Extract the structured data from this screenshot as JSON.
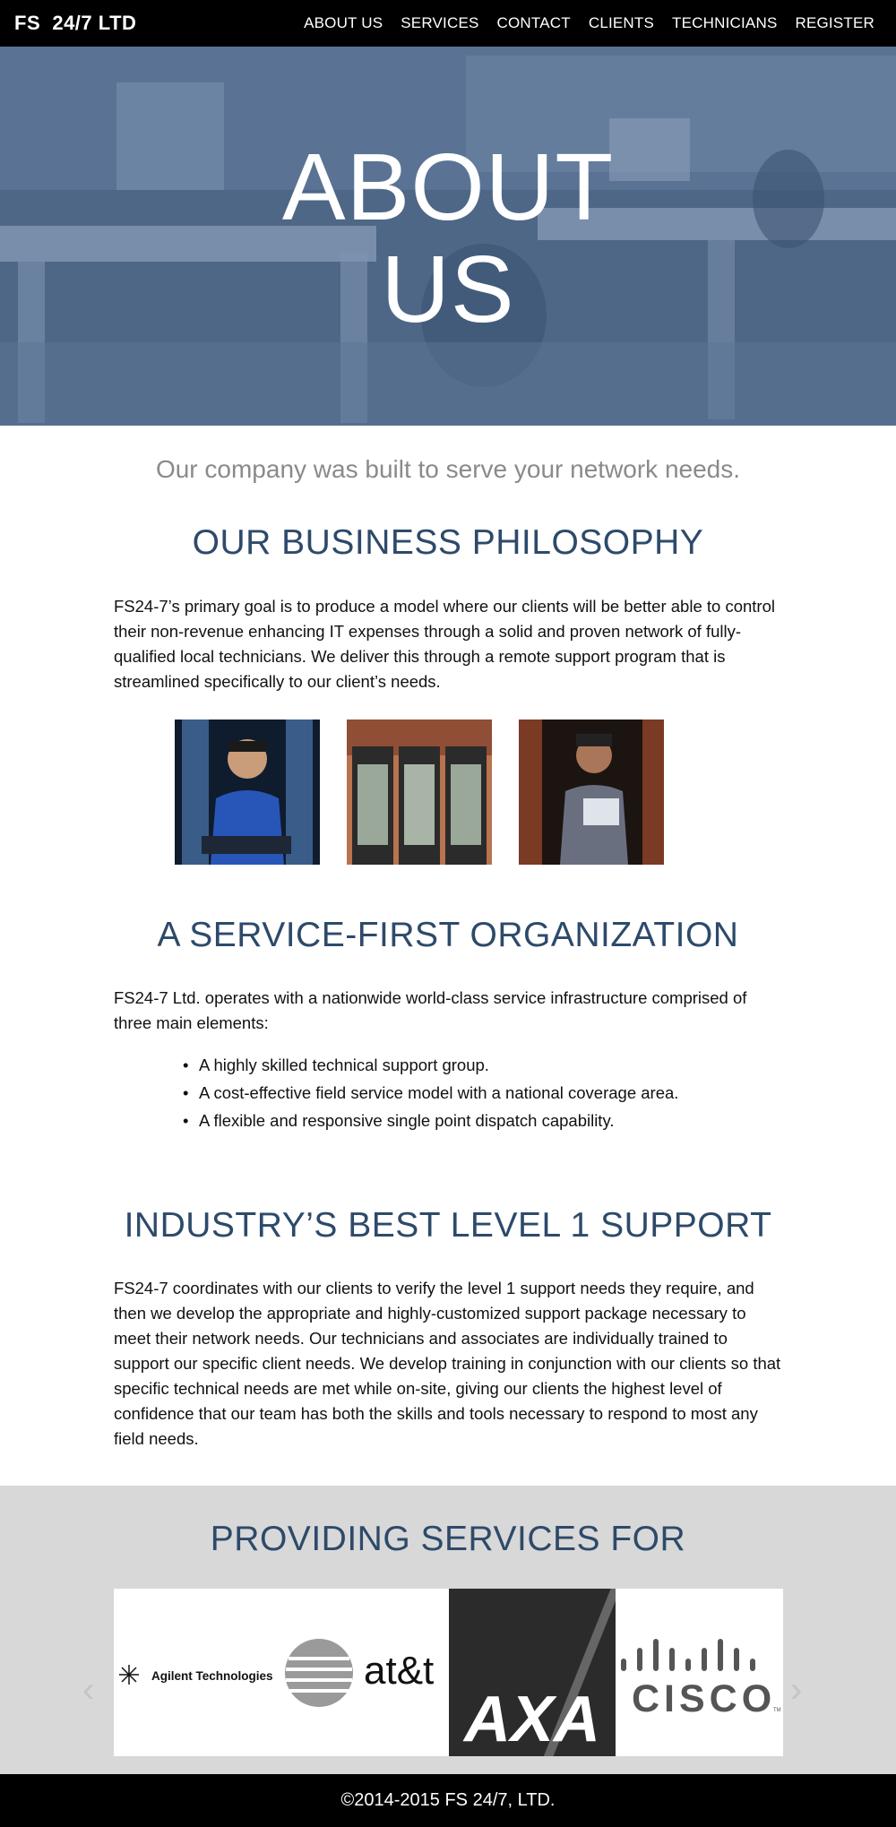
{
  "nav": {
    "brand": "FS  24/7 LTD",
    "links": [
      "ABOUT US",
      "SERVICES",
      "CONTACT",
      "CLIENTS",
      "TECHNICIANS",
      "REGISTER"
    ]
  },
  "hero": {
    "title_line1": "ABOUT",
    "title_line2": "US"
  },
  "tagline": "Our company was built to serve your network needs.",
  "philosophy": {
    "heading": "OUR BUSINESS PHILOSOPHY",
    "body": "FS24-7’s primary goal is to produce a model where our clients will be better able to control their non-revenue enhancing IT expenses through a solid and proven network of fully-qualified local technicians. We deliver this through a remote support program that is streamlined specifically to our client’s needs.",
    "photos": [
      "technician-at-server-photo",
      "server-racks-photo",
      "technician-with-tablet-photo"
    ]
  },
  "service_first": {
    "heading": "A SERVICE-FIRST ORGANIZATION",
    "body": "FS24-7 Ltd. operates with a nationwide world-class service infrastructure comprised of three main elements:",
    "bullets": [
      "A highly skilled technical support group.",
      "A cost-effective field service model with a national coverage area.",
      "A flexible and responsive single point dispatch capability."
    ]
  },
  "level1": {
    "heading": "INDUSTRY’S BEST LEVEL 1 SUPPORT",
    "body": "FS24-7 coordinates with our clients to verify the level 1 support needs they require, and then we develop the appropriate and highly-customized support package necessary to meet their network needs. Our technicians and associates are individually trained to support our specific client needs. We develop training in conjunction with our clients so that specific technical needs are met while on-site, giving our clients the highest level of confidence that our team has both the skills and tools necessary to respond to most any field needs."
  },
  "clients": {
    "heading": "PROVIDING SERVICES FOR",
    "logos": [
      "Agilent Technologies",
      "at&t",
      "AXA",
      "CISCO"
    ],
    "cisco_tm": "TM",
    "prev_icon": "chevron-left-icon",
    "next_icon": "chevron-right-icon"
  },
  "footer": {
    "copyright": "©2014-2015 FS 24/7, LTD."
  },
  "colors": {
    "heading_blue": "#2d4a6a",
    "hero_overlay": "#4b6585",
    "clients_bg": "#d8d8d8"
  }
}
